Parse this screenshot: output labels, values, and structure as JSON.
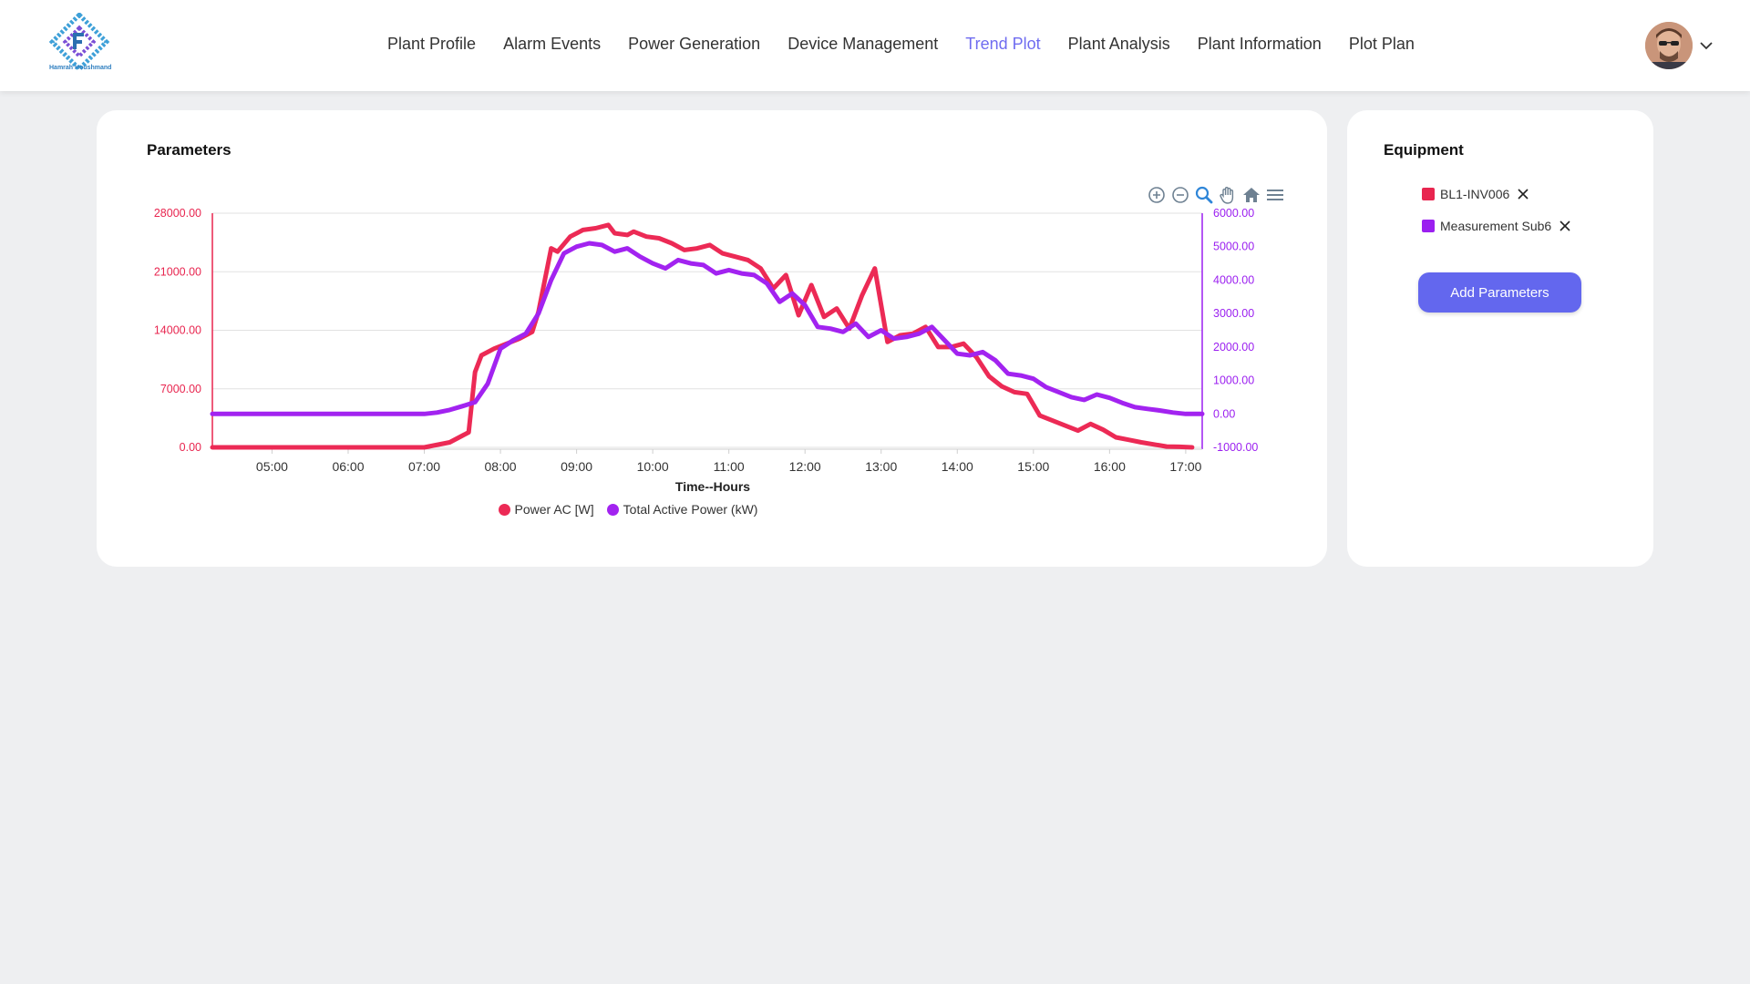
{
  "header": {
    "logo_text": "Hamrah Houshmand",
    "nav": [
      {
        "label": "Plant Profile",
        "active": false
      },
      {
        "label": "Alarm Events",
        "active": false
      },
      {
        "label": "Power Generation",
        "active": false
      },
      {
        "label": "Device Management",
        "active": false
      },
      {
        "label": "Trend Plot",
        "active": true
      },
      {
        "label": "Plant Analysis",
        "active": false
      },
      {
        "label": "Plant Information",
        "active": false
      },
      {
        "label": "Plot Plan",
        "active": false
      }
    ],
    "avatar_icon": "user-avatar",
    "menu_icon": "chevron-down-icon"
  },
  "parameters": {
    "title": "Parameters",
    "toolbar_icons": [
      "zoom-in-icon",
      "zoom-out-icon",
      "selection-zoom-icon",
      "pan-icon",
      "home-reset-icon",
      "menu-icon"
    ]
  },
  "equipment": {
    "title": "Equipment",
    "items": [
      {
        "label": "BL1-INV006",
        "color": "#e8254f"
      },
      {
        "label": "Measurement Sub6",
        "color": "#9b1ff0"
      }
    ],
    "add_label": "Add Parameters"
  },
  "colors": {
    "accent": "#6f6cf0",
    "series_1": "#ec2a55",
    "series_2": "#a223f0",
    "button": "#6367ee"
  },
  "chart_data": {
    "type": "line",
    "title": "",
    "xlabel": "Time--Hours",
    "x_ticks": [
      "05:00",
      "06:00",
      "07:00",
      "08:00",
      "09:00",
      "10:00",
      "11:00",
      "12:00",
      "13:00",
      "14:00",
      "15:00",
      "16:00",
      "17:00"
    ],
    "xlim": [
      "04:13",
      "17:13"
    ],
    "y_left": {
      "ylim": [
        0,
        28000
      ],
      "ticks": [
        "0.00",
        "7000.00",
        "14000.00",
        "21000.00",
        "28000.00"
      ],
      "color": "#e8254f"
    },
    "y_right": {
      "ylim": [
        -1000,
        6000
      ],
      "ticks": [
        "-1000.00",
        "0.00",
        "1000.00",
        "2000.00",
        "3000.00",
        "4000.00",
        "5000.00",
        "6000.00"
      ],
      "color": "#9b1ff0"
    },
    "grid": true,
    "legend_position": "bottom-center",
    "series": [
      {
        "name": "Power AC [W]",
        "axis": "left",
        "color": "#ec2a55",
        "x": [
          "04:13",
          "07:00",
          "07:20",
          "07:35",
          "07:40",
          "07:45",
          "07:55",
          "08:05",
          "08:15",
          "08:25",
          "08:30",
          "08:40",
          "08:45",
          "08:55",
          "09:05",
          "09:15",
          "09:25",
          "09:30",
          "09:40",
          "09:45",
          "09:55",
          "10:05",
          "10:15",
          "10:25",
          "10:35",
          "10:45",
          "10:55",
          "11:05",
          "11:15",
          "11:25",
          "11:35",
          "11:45",
          "11:55",
          "12:05",
          "12:15",
          "12:25",
          "12:35",
          "12:45",
          "12:55",
          "13:05",
          "13:15",
          "13:25",
          "13:35",
          "13:45",
          "13:55",
          "14:05",
          "14:15",
          "14:25",
          "14:35",
          "14:45",
          "14:55",
          "15:05",
          "15:15",
          "15:25",
          "15:35",
          "15:45",
          "15:55",
          "16:05",
          "16:15",
          "16:25",
          "16:35",
          "16:45",
          "16:55",
          "17:05"
        ],
        "y": [
          0,
          0,
          600,
          1800,
          9000,
          11000,
          11800,
          12400,
          13000,
          13800,
          16200,
          23800,
          23400,
          25200,
          26000,
          26200,
          26600,
          25600,
          25400,
          25800,
          25200,
          25000,
          24400,
          23600,
          23800,
          24200,
          23200,
          22800,
          22400,
          21400,
          19000,
          20600,
          15800,
          19400,
          15600,
          16600,
          14200,
          18200,
          21400,
          12600,
          13400,
          13600,
          14400,
          12000,
          12000,
          12400,
          10800,
          8500,
          7300,
          6600,
          6400,
          3800,
          3200,
          2600,
          2000,
          2800,
          2100,
          1200,
          900,
          600,
          350,
          100,
          60,
          0
        ]
      },
      {
        "name": "Total Active Power (kW)",
        "axis": "right",
        "color": "#a223f0",
        "x": [
          "04:13",
          "07:00",
          "07:10",
          "07:20",
          "07:30",
          "07:40",
          "07:50",
          "08:00",
          "08:10",
          "08:20",
          "08:30",
          "08:40",
          "08:50",
          "09:00",
          "09:10",
          "09:20",
          "09:30",
          "09:40",
          "09:50",
          "10:00",
          "10:10",
          "10:20",
          "10:30",
          "10:40",
          "10:50",
          "11:00",
          "11:10",
          "11:20",
          "11:30",
          "11:40",
          "11:50",
          "12:00",
          "12:10",
          "12:20",
          "12:30",
          "12:40",
          "12:50",
          "13:00",
          "13:10",
          "13:20",
          "13:30",
          "13:40",
          "13:50",
          "14:00",
          "14:10",
          "14:20",
          "14:30",
          "14:40",
          "14:50",
          "15:00",
          "15:10",
          "15:20",
          "15:30",
          "15:40",
          "15:50",
          "16:00",
          "16:10",
          "16:20",
          "16:30",
          "16:40",
          "16:50",
          "17:00",
          "17:13"
        ],
        "y": [
          0,
          0,
          40,
          120,
          230,
          350,
          900,
          1950,
          2200,
          2400,
          3000,
          4000,
          4800,
          5000,
          5100,
          5050,
          4850,
          4950,
          4700,
          4500,
          4350,
          4600,
          4500,
          4450,
          4200,
          4300,
          4200,
          4150,
          3900,
          3350,
          3600,
          3250,
          2600,
          2550,
          2450,
          2700,
          2300,
          2500,
          2250,
          2300,
          2400,
          2600,
          2200,
          1800,
          1750,
          1850,
          1600,
          1200,
          1150,
          1050,
          800,
          650,
          500,
          420,
          580,
          480,
          330,
          200,
          150,
          100,
          40,
          0,
          0
        ]
      }
    ]
  }
}
